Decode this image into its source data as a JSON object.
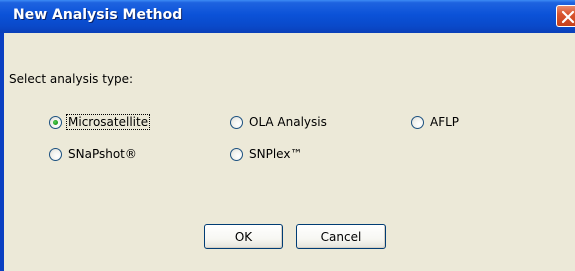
{
  "window": {
    "title": "New Analysis Method",
    "close_icon": "close-icon",
    "title_bar_color": "#0b52d8",
    "close_button_color": "#d9552f"
  },
  "dialog": {
    "prompt": "Select analysis type:",
    "options": [
      {
        "label": "Microsatellite",
        "selected": true
      },
      {
        "label": "OLA Analysis",
        "selected": false
      },
      {
        "label": "AFLP",
        "selected": false
      },
      {
        "label": "SNaPshot®",
        "selected": false
      },
      {
        "label": "SNPlex™",
        "selected": false
      }
    ],
    "ok_label": "OK",
    "cancel_label": "Cancel"
  }
}
